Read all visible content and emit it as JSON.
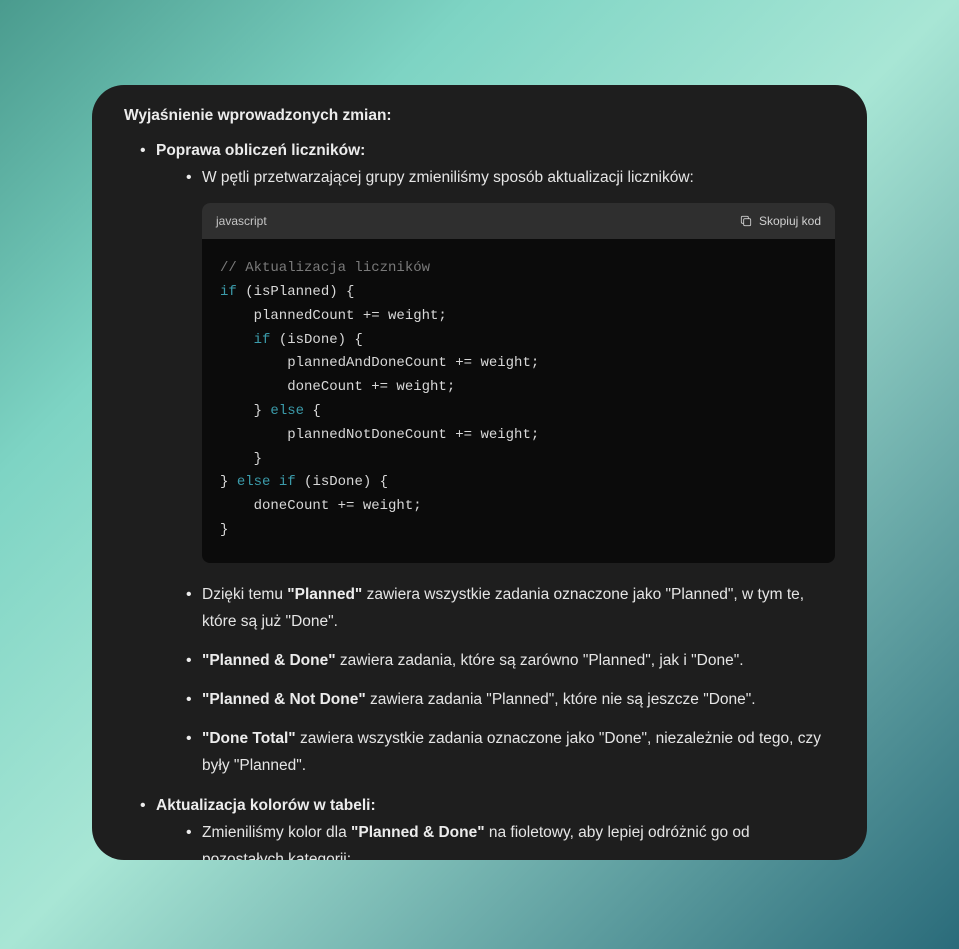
{
  "heading": "Wyjaśnienie wprowadzonych zmian:",
  "item1": {
    "title": "Poprawa obliczeń liczników:",
    "intro": "W pętli przetwarzającej grupy zmieniliśmy sposób aktualizacji liczników:",
    "code_lang": "javascript",
    "copy_label": "Skopiuj kod",
    "code": {
      "c0": "// Aktualizacja liczników",
      "k_if": "if",
      "k_else": "else",
      "l1a": " (isPlanned) {",
      "l2": "    plannedCount += weight;",
      "l3a": "    ",
      "l3b": " (isDone) {",
      "l4": "        plannedAndDoneCount += weight;",
      "l5": "        doneCount += weight;",
      "l6a": "    } ",
      "l6b": " {",
      "l7": "        plannedNotDoneCount += weight;",
      "l8": "    }",
      "l9a": "} ",
      "l9b": " ",
      "l9c": " (isDone) {",
      "l10": "    doneCount += weight;",
      "l11": "}"
    },
    "bullets": [
      {
        "pre": "Dzięki temu ",
        "bold": "\"Planned\"",
        "post": " zawiera wszystkie zadania oznaczone jako \"Planned\", w tym te, które są już \"Done\"."
      },
      {
        "pre": "",
        "bold": "\"Planned & Done\"",
        "post": " zawiera zadania, które są zarówno \"Planned\", jak i \"Done\"."
      },
      {
        "pre": "",
        "bold": "\"Planned & Not Done\"",
        "post": " zawiera zadania \"Planned\", które nie są jeszcze \"Done\"."
      },
      {
        "pre": "",
        "bold": "\"Done Total\"",
        "post": " zawiera wszystkie zadania oznaczone jako \"Done\", niezależnie od tego, czy były \"Planned\"."
      }
    ]
  },
  "item2": {
    "title": "Aktualizacja kolorów w tabeli:",
    "bullet": {
      "pre": "Zmieniliśmy kolor dla ",
      "bold": "\"Planned & Done\"",
      "post": " na fioletowy, aby lepiej odróżnić go od pozostałych kategorii:"
    }
  }
}
